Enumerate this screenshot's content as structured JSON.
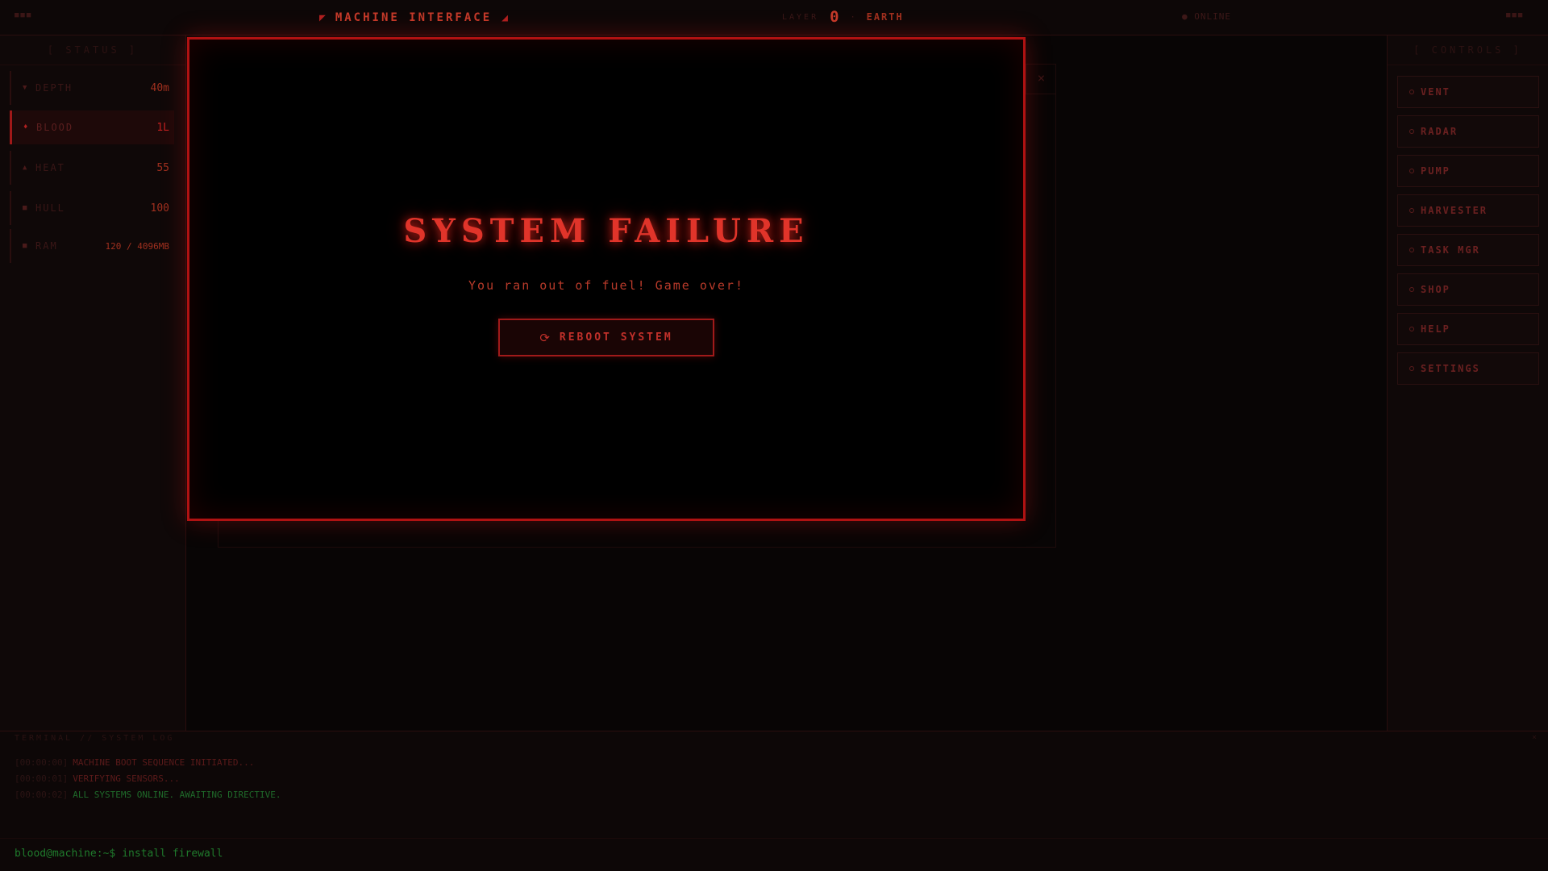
{
  "topbar": {
    "left_dots": "■■■",
    "right_dots": "■■■",
    "title": "MACHINE INTERFACE",
    "layer_label": "LAYER",
    "layer_value": "0",
    "layer_separator": "·",
    "layer_place": "EARTH",
    "status": "● ONLINE"
  },
  "left_panel": {
    "header": "[ STATUS ]",
    "stats": [
      {
        "icon": "▼",
        "label": "DEPTH",
        "value": "40m"
      },
      {
        "icon": "♦",
        "label": "BLOOD",
        "value": "1L"
      },
      {
        "icon": "▲",
        "label": "HEAT",
        "value": "55"
      },
      {
        "icon": "■",
        "label": "HULL",
        "value": "100"
      },
      {
        "icon": "■",
        "label": "RAM",
        "value": "120 / 4096MB"
      }
    ]
  },
  "right_panel": {
    "header": "[ CONTROLS ]",
    "controls": [
      {
        "label": "VENT"
      },
      {
        "label": "RADAR"
      },
      {
        "label": "PUMP"
      },
      {
        "label": "HARVESTER"
      },
      {
        "label": "TASK MGR"
      },
      {
        "label": "SHOP"
      },
      {
        "label": "HELP"
      },
      {
        "label": "SETTINGS"
      }
    ]
  },
  "ghost_window": {
    "close": "×"
  },
  "terminal": {
    "header": "TERMINAL // SYSTEM LOG",
    "close": "×",
    "logs": [
      {
        "ts": "[00:00:00]",
        "msg": "MACHINE BOOT SEQUENCE INITIATED..."
      },
      {
        "ts": "[00:00:01]",
        "msg": "VERIFYING SENSORS..."
      },
      {
        "ts": "[00:00:02]",
        "msg": "ALL SYSTEMS ONLINE. AWAITING DIRECTIVE."
      }
    ],
    "prompt": "blood@machine:~$",
    "command": "install firewall"
  },
  "modal": {
    "title": "SYSTEM FAILURE",
    "message": "You ran out of fuel! Game over!",
    "button_icon": "⟳",
    "button_label": "REBOOT SYSTEM"
  }
}
